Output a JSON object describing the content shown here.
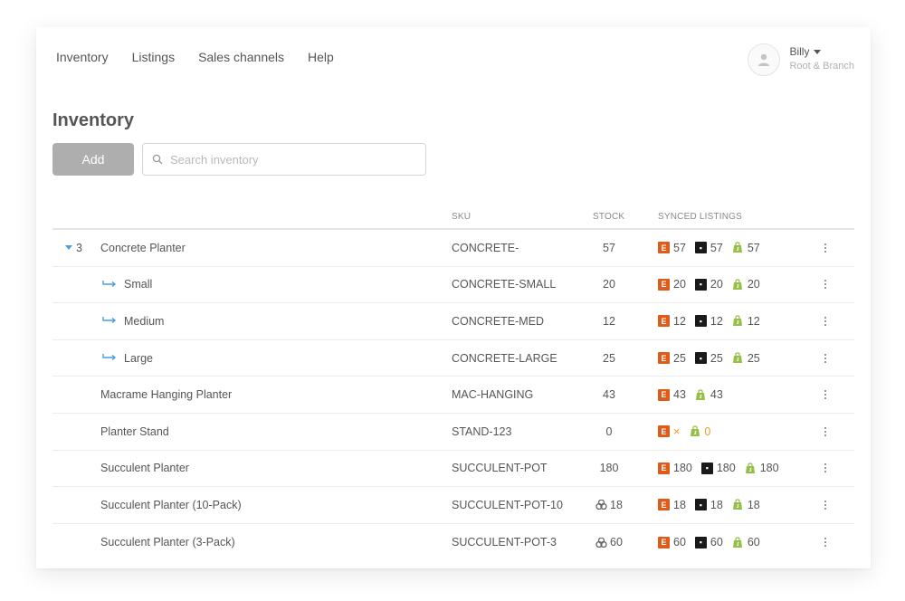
{
  "nav": {
    "items": [
      "Inventory",
      "Listings",
      "Sales channels",
      "Help"
    ]
  },
  "user": {
    "name": "Billy",
    "org": "Root & Branch"
  },
  "page": {
    "title": "Inventory",
    "add_label": "Add",
    "search_placeholder": "Search inventory"
  },
  "table": {
    "headers": {
      "sku": "SKU",
      "stock": "STOCK",
      "synced": "SYNCED LISTINGS"
    },
    "rows": [
      {
        "toggle": "3",
        "name": "Concrete Planter",
        "sku": "CONCRETE-",
        "stock": "57",
        "etsy": "57",
        "square": "57",
        "shopify": "57"
      },
      {
        "child": true,
        "name": "Small",
        "sku": "CONCRETE-SMALL",
        "stock": "20",
        "etsy": "20",
        "square": "20",
        "shopify": "20"
      },
      {
        "child": true,
        "name": "Medium",
        "sku": "CONCRETE-MED",
        "stock": "12",
        "etsy": "12",
        "square": "12",
        "shopify": "12"
      },
      {
        "child": true,
        "name": "Large",
        "sku": "CONCRETE-LARGE",
        "stock": "25",
        "etsy": "25",
        "square": "25",
        "shopify": "25"
      },
      {
        "name": "Macrame Hanging Planter",
        "sku": "MAC-HANGING",
        "stock": "43",
        "etsy": "43",
        "shopify": "43"
      },
      {
        "name": "Planter Stand",
        "sku": "STAND-123",
        "stock": "0",
        "etsy": "×",
        "shopify": "0",
        "warn": true
      },
      {
        "name": "Succulent Planter",
        "sku": "SUCCULENT-POT",
        "stock": "180",
        "etsy": "180",
        "square": "180",
        "shopify": "180"
      },
      {
        "name": "Succulent Planter (10-Pack)",
        "sku": "SUCCULENT-POT-10",
        "stock": "18",
        "bundle": true,
        "etsy": "18",
        "square": "18",
        "shopify": "18"
      },
      {
        "name": "Succulent Planter (3-Pack)",
        "sku": "SUCCULENT-POT-3",
        "stock": "60",
        "bundle": true,
        "etsy": "60",
        "square": "60",
        "shopify": "60"
      }
    ]
  },
  "colors": {
    "accent": "#4a9fe0",
    "etsy": "#e05b1a",
    "square": "#1a1a1a",
    "shopify": "#95bf47",
    "warning": "#f29a1c"
  }
}
